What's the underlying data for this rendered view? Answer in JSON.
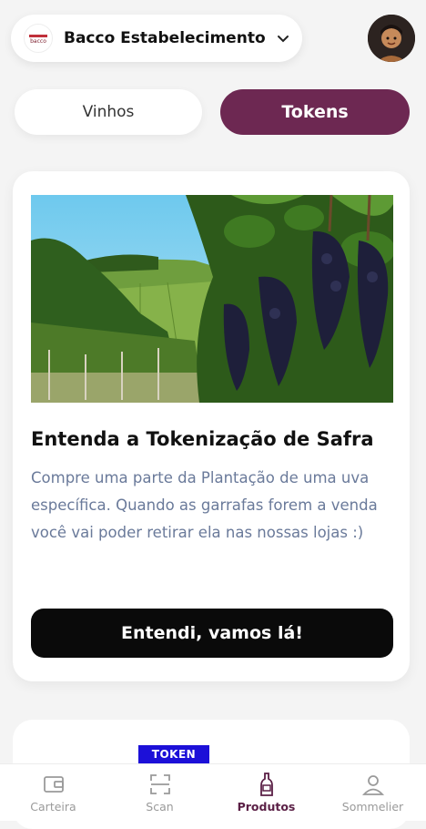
{
  "header": {
    "establishment": "Bacco Estabelecimento",
    "logo_text": "bacco"
  },
  "tabs": [
    {
      "label": "Vinhos",
      "active": false
    },
    {
      "label": "Tokens",
      "active": true
    }
  ],
  "card": {
    "title": "Entenda a Tokenização de Safra",
    "description": "Compre uma parte da Plantação de uma uva específica. Quando as garrafas forem a venda você vai poder retirar ela nas nossas lojas :)",
    "cta_label": "Entendi, vamos lá!"
  },
  "next_card": {
    "badge": "TOKEN"
  },
  "bottom_nav": [
    {
      "label": "Carteira",
      "icon": "wallet-icon"
    },
    {
      "label": "Scan",
      "icon": "scan-icon"
    },
    {
      "label": "Produtos",
      "icon": "wine-bottle-icon",
      "active": true
    },
    {
      "label": "Sommelier",
      "icon": "user-icon"
    }
  ],
  "colors": {
    "accent": "#6d2852",
    "badge": "#1c10d8",
    "cta": "#0a0a0a"
  }
}
